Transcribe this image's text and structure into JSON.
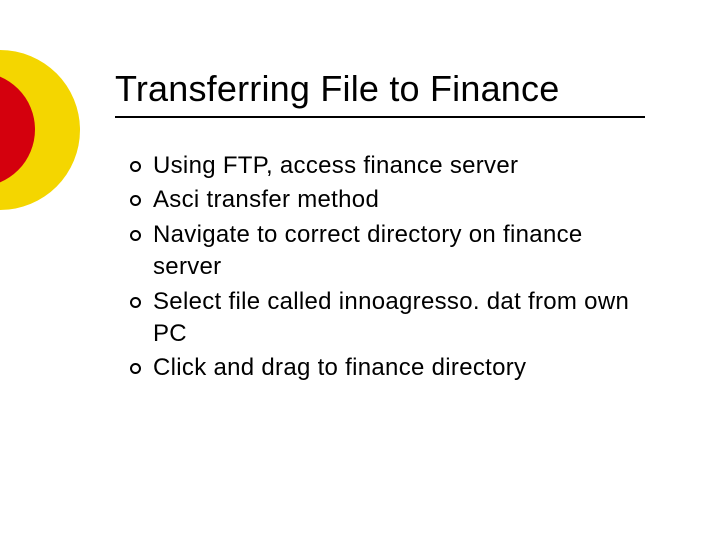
{
  "title": "Transferring File to Finance",
  "bullets": [
    "Using FTP, access finance server",
    "Asci transfer method",
    "Navigate to correct directory on finance server",
    "Select file called innoagresso. dat from own PC",
    "Click and drag to finance directory"
  ]
}
